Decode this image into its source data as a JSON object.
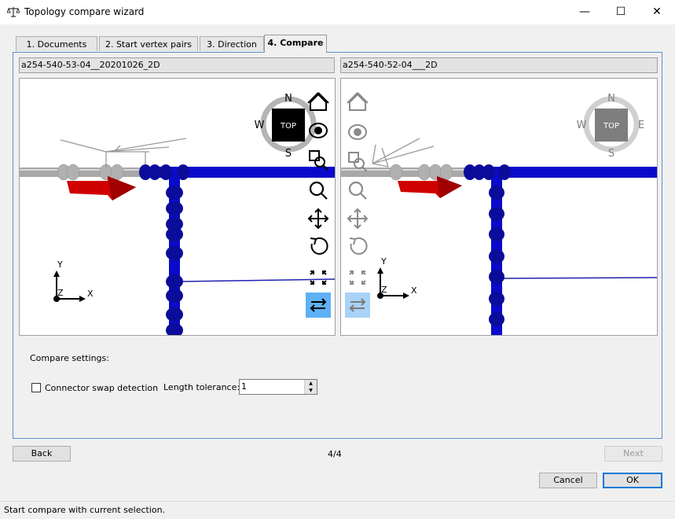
{
  "window": {
    "title": "Topology compare wizard",
    "minimize": "—",
    "maximize": "☐",
    "close": "✕"
  },
  "tabs": [
    {
      "label": "1. Documents"
    },
    {
      "label": "2. Start vertex pairs"
    },
    {
      "label": "3. Direction"
    },
    {
      "label": "4. Compare"
    }
  ],
  "left_view": {
    "title": "a254-540-53-04__20201026_2D",
    "compass": {
      "n": "N",
      "s": "S",
      "w": "W",
      "top": "TOP"
    },
    "axes": {
      "x": "X",
      "y": "Y",
      "z": "Z"
    }
  },
  "right_view": {
    "title": "a254-540-52-04___2D",
    "compass": {
      "n": "N",
      "s": "S",
      "w": "W",
      "e": "E",
      "top": "TOP"
    },
    "axes": {
      "x": "X",
      "y": "Y",
      "z": "Z"
    }
  },
  "settings": {
    "heading": "Compare settings:",
    "swap_label": "Connector swap detection",
    "swap_checked": false,
    "tolerance_label": "Length tolerance:",
    "tolerance_value": "1"
  },
  "nav": {
    "back": "Back",
    "page": "4/4",
    "next": "Next",
    "cancel": "Cancel",
    "ok": "OK"
  },
  "status": "Start compare with current selection.",
  "colors": {
    "accent": "#0078d7",
    "pipe_blue": "#0a0acc",
    "arrow_red": "#d00000",
    "toggle_active": "#5fb0f5"
  }
}
